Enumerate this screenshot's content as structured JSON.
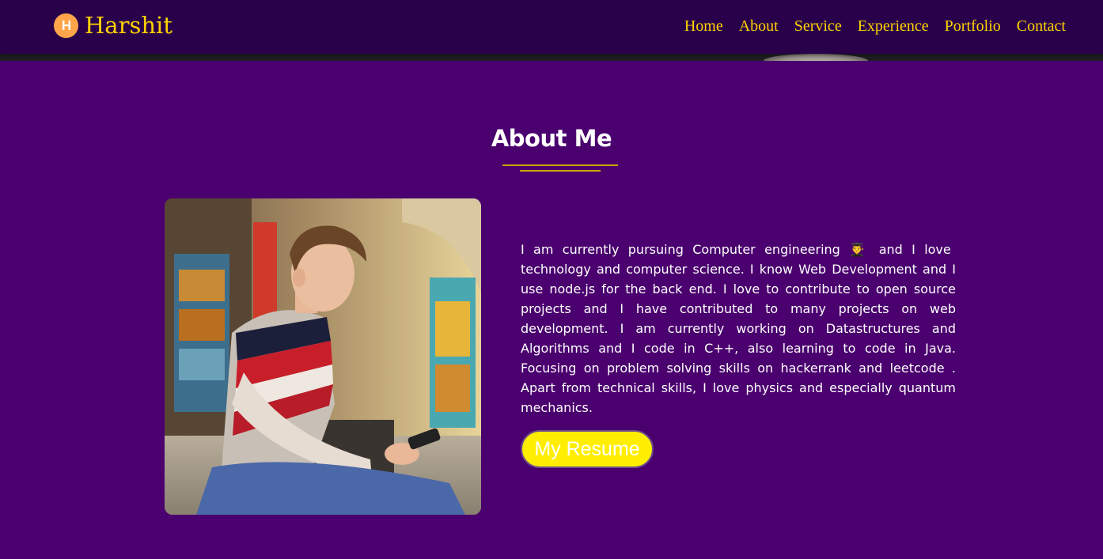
{
  "navbar": {
    "brand_icon": "h-monogram-icon",
    "brand_name": "Harshit",
    "links": [
      "Home",
      "About",
      "Service",
      "Experience",
      "Portfolio",
      "Contact"
    ]
  },
  "about": {
    "title": "About Me",
    "paragraph": "I am currently pursuing Computer engineering 👨‍🎓 and I love technology and computer science. I know Web Development and I use node.js for the back end. I love to contribute to open source projects and I have contributed to many projects on web development. I am currently working on Datastructures and Algorithms and I code in C++, also learning to code in Java. Focusing on problem solving skills on hackerrank and leetcode . Apart from technical skills, I love physics and especially quantum mechanics.",
    "resume_label": "My Resume"
  },
  "colors": {
    "background": "#4a006e",
    "navbar": "#29004a",
    "accent": "#ffd200",
    "button": "#ffee00"
  }
}
